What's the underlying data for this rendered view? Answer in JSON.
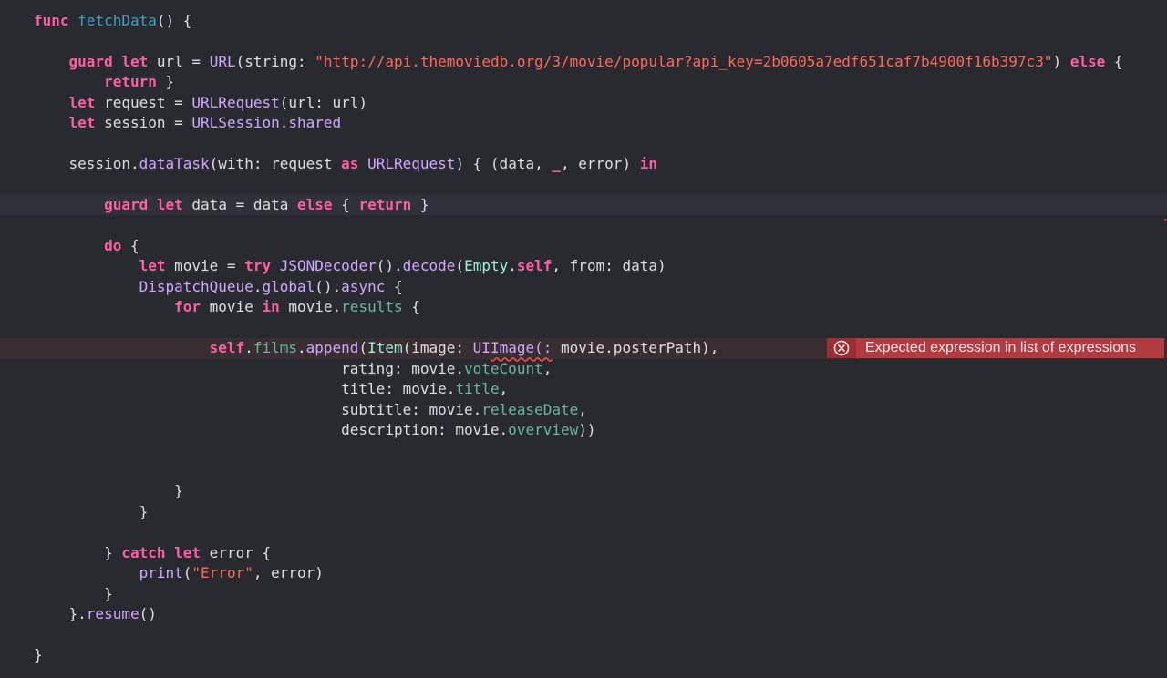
{
  "editor": {
    "error": {
      "icon": "error-circle-x-icon",
      "message": "Expected expression in list of expressions",
      "color": "#b23a40"
    },
    "theme": {
      "background": "#292a30",
      "keyword": "#fc5fa3",
      "string": "#fc6a5d",
      "type": "#d0a8ff",
      "declaration": "#41a1c0",
      "property": "#67b7a4",
      "project_type": "#9ef1dd",
      "plain": "#dfdfe0"
    },
    "lines": [
      [
        [
          "kw",
          "func"
        ],
        [
          "p",
          " "
        ],
        [
          "decl",
          "fetchData"
        ],
        [
          "p",
          "() {"
        ]
      ],
      [],
      [
        [
          "p",
          "    "
        ],
        [
          "kw",
          "guard"
        ],
        [
          "p",
          " "
        ],
        [
          "kw",
          "let"
        ],
        [
          "p",
          " url = "
        ],
        [
          "type",
          "URL"
        ],
        [
          "p",
          "(string: "
        ],
        [
          "str",
          "\"http://api.themoviedb.org/3/movie/popular?api_key=2b0605a7edf651caf7b4900f16b397c3\""
        ],
        [
          "p",
          ") "
        ],
        [
          "kw",
          "else"
        ],
        [
          "p",
          " {"
        ]
      ],
      [
        [
          "p",
          "        "
        ],
        [
          "kw",
          "return"
        ],
        [
          "p",
          " }"
        ]
      ],
      [
        [
          "p",
          "    "
        ],
        [
          "kw",
          "let"
        ],
        [
          "p",
          " request = "
        ],
        [
          "type",
          "URLRequest"
        ],
        [
          "p",
          "(url: url)"
        ]
      ],
      [
        [
          "p",
          "    "
        ],
        [
          "kw",
          "let"
        ],
        [
          "p",
          " session = "
        ],
        [
          "type",
          "URLSession"
        ],
        [
          "p",
          "."
        ],
        [
          "type",
          "shared"
        ]
      ],
      [],
      [
        [
          "p",
          "    session."
        ],
        [
          "type",
          "dataTask"
        ],
        [
          "p",
          "(with: request "
        ],
        [
          "kw",
          "as"
        ],
        [
          "p",
          " "
        ],
        [
          "type",
          "URLRequest"
        ],
        [
          "p",
          ") { (data, "
        ],
        [
          "kw",
          "_"
        ],
        [
          "p",
          ", error) "
        ],
        [
          "kw",
          "in"
        ]
      ],
      [],
      [
        [
          "p",
          "        "
        ],
        [
          "kw",
          "guard"
        ],
        [
          "p",
          " "
        ],
        [
          "kw",
          "let"
        ],
        [
          "p",
          " data = data "
        ],
        [
          "kw",
          "else"
        ],
        [
          "p",
          " { "
        ],
        [
          "kw",
          "return"
        ],
        [
          "p",
          " }"
        ]
      ],
      [],
      [
        [
          "p",
          "        "
        ],
        [
          "kw",
          "do"
        ],
        [
          "p",
          " {"
        ]
      ],
      [
        [
          "p",
          "            "
        ],
        [
          "kw",
          "let"
        ],
        [
          "p",
          " movie = "
        ],
        [
          "kw",
          "try"
        ],
        [
          "p",
          " "
        ],
        [
          "type",
          "JSONDecoder"
        ],
        [
          "p",
          "()."
        ],
        [
          "type",
          "decode"
        ],
        [
          "p",
          "("
        ],
        [
          "projtype",
          "Empty"
        ],
        [
          "p",
          "."
        ],
        [
          "kw",
          "self"
        ],
        [
          "p",
          ", from: data)"
        ]
      ],
      [
        [
          "p",
          "            "
        ],
        [
          "type",
          "DispatchQueue"
        ],
        [
          "p",
          "."
        ],
        [
          "type",
          "global"
        ],
        [
          "p",
          "()."
        ],
        [
          "type",
          "async"
        ],
        [
          "p",
          " {"
        ]
      ],
      [
        [
          "p",
          "                "
        ],
        [
          "kw",
          "for"
        ],
        [
          "p",
          " movie "
        ],
        [
          "kw",
          "in"
        ],
        [
          "p",
          " movie."
        ],
        [
          "proj",
          "results"
        ],
        [
          "p",
          " {"
        ]
      ],
      [],
      [
        [
          "p",
          "                    "
        ],
        [
          "kw",
          "self"
        ],
        [
          "p",
          "."
        ],
        [
          "proj",
          "films"
        ],
        [
          "p",
          "."
        ],
        [
          "type",
          "append"
        ],
        [
          "p",
          "("
        ],
        [
          "projtype",
          "Item"
        ],
        [
          "p",
          "(image: "
        ],
        [
          "type",
          "UI"
        ],
        [
          "err",
          "Image(:"
        ],
        [
          "p",
          " movie.posterPath),"
        ]
      ],
      [
        [
          "p",
          "                                   rating: movie."
        ],
        [
          "proj",
          "voteCount"
        ],
        [
          "p",
          ","
        ]
      ],
      [
        [
          "p",
          "                                   title: movie."
        ],
        [
          "proj",
          "title"
        ],
        [
          "p",
          ","
        ]
      ],
      [
        [
          "p",
          "                                   subtitle: movie."
        ],
        [
          "proj",
          "releaseDate"
        ],
        [
          "p",
          ","
        ]
      ],
      [
        [
          "p",
          "                                   description: movie."
        ],
        [
          "proj",
          "overview"
        ],
        [
          "p",
          "))"
        ]
      ],
      [],
      [],
      [
        [
          "p",
          "                }"
        ]
      ],
      [
        [
          "p",
          "            }"
        ]
      ],
      [],
      [
        [
          "p",
          "        } "
        ],
        [
          "kw",
          "catch"
        ],
        [
          "p",
          " "
        ],
        [
          "kw",
          "let"
        ],
        [
          "p",
          " error {"
        ]
      ],
      [
        [
          "p",
          "            "
        ],
        [
          "type",
          "print"
        ],
        [
          "p",
          "("
        ],
        [
          "str",
          "\"Error\""
        ],
        [
          "p",
          ", error)"
        ]
      ],
      [
        [
          "p",
          "        }"
        ]
      ],
      [
        [
          "p",
          "    }."
        ],
        [
          "type",
          "resume"
        ],
        [
          "p",
          "()"
        ]
      ],
      [],
      [
        [
          "p",
          "}"
        ]
      ]
    ],
    "current_line": 9,
    "error_line": 16
  }
}
